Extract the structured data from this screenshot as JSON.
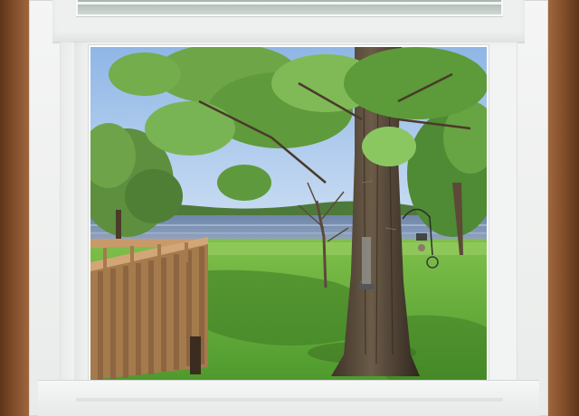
{
  "scene": {
    "subject": "window view",
    "icons": [
      "tree-icon",
      "deck-railing-icon",
      "lake-icon",
      "bird-feeder-icon"
    ]
  },
  "colors": {
    "sky": "#a9c8ec",
    "lake": "#7e93b3",
    "grass": "#5ca83a",
    "deck": "#b58a5c",
    "frame": "#eef0ef",
    "wall": "#7a4a2a"
  }
}
